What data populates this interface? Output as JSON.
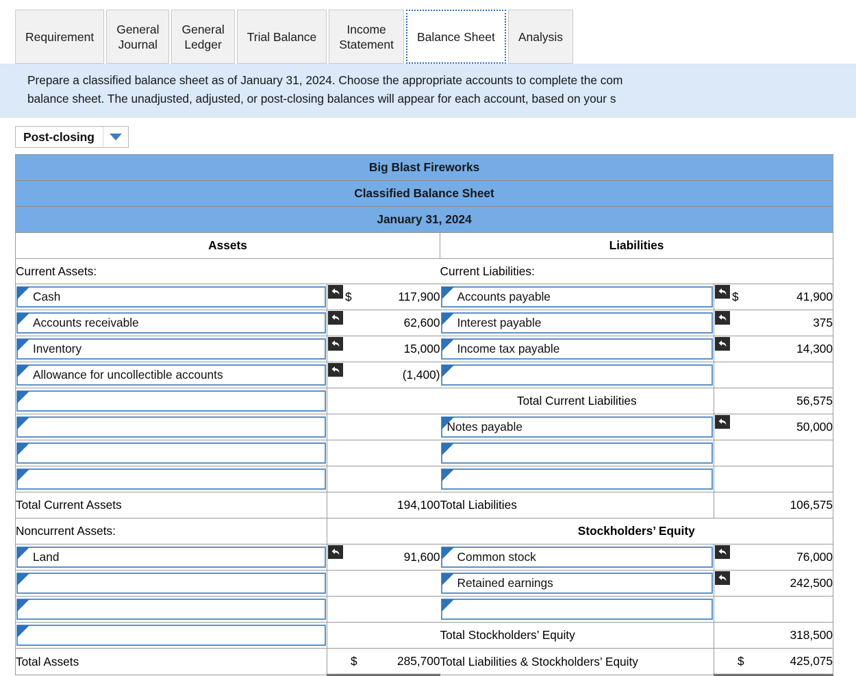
{
  "tabs": [
    {
      "label": "Requirement",
      "active": false
    },
    {
      "label": "General\nJournal",
      "active": false
    },
    {
      "label": "General\nLedger",
      "active": false
    },
    {
      "label": "Trial Balance",
      "active": false
    },
    {
      "label": "Income\nStatement",
      "active": false
    },
    {
      "label": "Balance Sheet",
      "active": true
    },
    {
      "label": "Analysis",
      "active": false
    }
  ],
  "instructions": {
    "line1": "Prepare a classified balance sheet as of January 31, 2024. Choose the appropriate accounts to complete the com",
    "line2": "balance sheet. The unadjusted, adjusted, or post-closing balances will appear for each account, based on your s"
  },
  "dropdown": {
    "value": "Post-closing",
    "caret": "chevron-down-icon"
  },
  "sheet": {
    "company": "Big Blast Fireworks",
    "statement": "Classified Balance Sheet",
    "date": "January 31, 2024",
    "assets_header": "Assets",
    "liabilities_header": "Liabilities",
    "equity_header": "Stockholders’ Equity",
    "current_assets_label": "Current Assets:",
    "current_liabilities_label": "Current Liabilities:",
    "noncurrent_assets_label": "Noncurrent Assets:",
    "assets_rows": [
      {
        "label": "Cash",
        "currency": "$",
        "value": "117,900",
        "filled": true
      },
      {
        "label": "Accounts receivable",
        "currency": "",
        "value": "62,600",
        "filled": true
      },
      {
        "label": "Inventory",
        "currency": "",
        "value": "15,000",
        "filled": true
      },
      {
        "label": "Allowance for uncollectible accounts",
        "currency": "",
        "value": "(1,400)",
        "filled": true
      },
      {
        "label": "",
        "currency": "",
        "value": "",
        "filled": false
      },
      {
        "label": "",
        "currency": "",
        "value": "",
        "filled": false
      },
      {
        "label": "",
        "currency": "",
        "value": "",
        "filled": false
      },
      {
        "label": "",
        "currency": "",
        "value": "",
        "filled": false
      }
    ],
    "total_current_assets": {
      "label": "Total Current Assets",
      "value": "194,100"
    },
    "noncurrent_assets_rows": [
      {
        "label": "Land",
        "currency": "",
        "value": "91,600",
        "filled": true
      },
      {
        "label": "",
        "currency": "",
        "value": "",
        "filled": false
      },
      {
        "label": "",
        "currency": "",
        "value": "",
        "filled": false
      },
      {
        "label": "",
        "currency": "",
        "value": "",
        "filled": false
      }
    ],
    "total_assets": {
      "label": "Total Assets",
      "currency": "$",
      "value": "285,700"
    },
    "liabilities_rows": [
      {
        "label": "Accounts payable",
        "currency": "$",
        "value": "41,900",
        "filled": true
      },
      {
        "label": "Interest payable",
        "currency": "",
        "value": "375",
        "filled": true
      },
      {
        "label": "Income tax payable",
        "currency": "",
        "value": "14,300",
        "filled": true
      },
      {
        "label": "",
        "currency": "",
        "value": "",
        "filled": false
      }
    ],
    "total_current_liabilities": {
      "label": "Total Current Liabilities",
      "value": "56,575"
    },
    "noncurrent_liabilities_rows": [
      {
        "label": "Notes payable",
        "currency": "",
        "value": "50,000",
        "filled": true,
        "noindent": true
      },
      {
        "label": "",
        "currency": "",
        "value": "",
        "filled": false
      },
      {
        "label": "",
        "currency": "",
        "value": "",
        "filled": false
      }
    ],
    "total_liabilities": {
      "label": "Total Liabilities",
      "value": "106,575"
    },
    "equity_rows": [
      {
        "label": "Common stock",
        "currency": "",
        "value": "76,000",
        "filled": true
      },
      {
        "label": "Retained earnings",
        "currency": "",
        "value": "242,500",
        "filled": true
      },
      {
        "label": "",
        "currency": "",
        "value": "",
        "filled": false
      }
    ],
    "total_equity": {
      "label": "Total Stockholders’ Equity",
      "value": "318,500"
    },
    "total_liab_equity": {
      "label": "Total Liabilities & Stockholders’ Equity",
      "currency": "$",
      "value": "425,075"
    }
  },
  "colors": {
    "header_blue": "#76ace5",
    "banner_blue": "#dbe9f8",
    "input_border": "#5b91c9",
    "marker_blue": "#2e72b8",
    "badge_dark": "#2b2b2b"
  }
}
